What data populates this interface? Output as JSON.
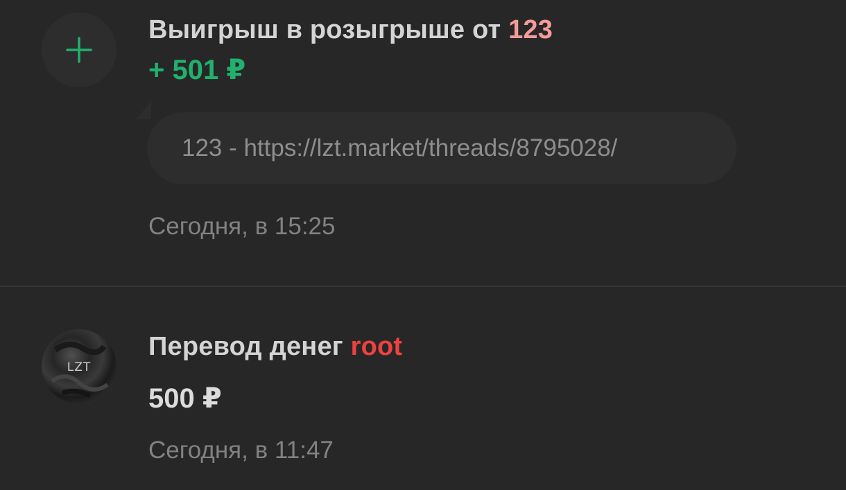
{
  "feed": {
    "entries": [
      {
        "icon": "plus-icon",
        "title_prefix": "Выигрыш в розыгрыше от",
        "title_user": "123",
        "amount": "+ 501 ₽",
        "comment": "123 - https://lzt.market/threads/8795028/",
        "timestamp": "Сегодня, в 15:25",
        "colors": {
          "amount": "#22b06e",
          "user": "#f59a9a"
        }
      },
      {
        "icon": "avatar-image",
        "avatar_text": "LZT",
        "title_prefix": "Перевод денег",
        "title_user": "root",
        "amount": "500 ₽",
        "timestamp": "Сегодня, в 11:47",
        "colors": {
          "amount": "#dcdcdc",
          "user": "#ef4141"
        }
      }
    ]
  }
}
